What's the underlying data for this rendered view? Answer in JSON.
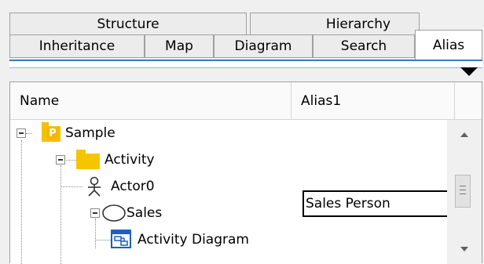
{
  "tabs": {
    "row1": [
      {
        "label": "Structure"
      },
      {
        "label": "Hierarchy"
      }
    ],
    "row2": [
      {
        "label": "Inheritance"
      },
      {
        "label": "Map"
      },
      {
        "label": "Diagram"
      },
      {
        "label": "Search"
      }
    ],
    "active": {
      "label": "Alias"
    }
  },
  "grid": {
    "columns": [
      "Name",
      "Alias1"
    ],
    "rows": [
      {
        "name": "Sample",
        "alias": "",
        "icon": "package-icon"
      },
      {
        "name": "Activity",
        "alias": "",
        "icon": "folder-icon"
      },
      {
        "name": "Actor0",
        "alias": "Sales Person",
        "icon": "actor-icon"
      },
      {
        "name": "Sales",
        "alias": "",
        "icon": "usecase-icon"
      },
      {
        "name": "Activity Diagram",
        "alias": "",
        "icon": "diagram-icon"
      }
    ],
    "package_letter": "P"
  }
}
